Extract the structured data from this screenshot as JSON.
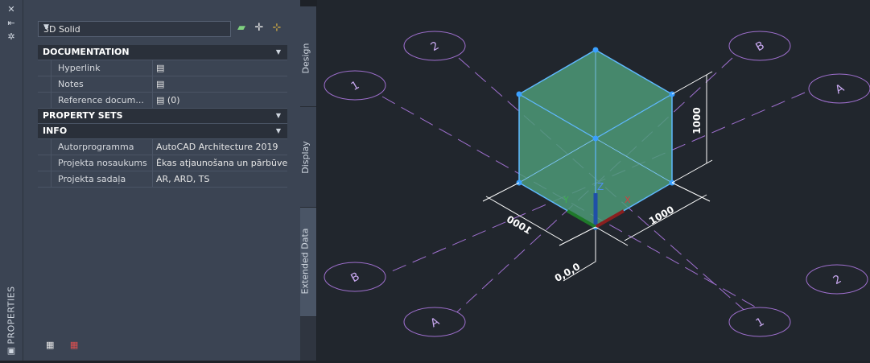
{
  "sidebar": {
    "title": "PROPERTIES",
    "icons": [
      "close-icon",
      "auto-hide-icon",
      "settings-icon",
      "properties-icon"
    ]
  },
  "object_selector": {
    "value": "3D Solid",
    "tool_icons": [
      "add-object-icon",
      "select-objects-icon",
      "quick-select-icon"
    ]
  },
  "sections": [
    {
      "title": "DOCUMENTATION",
      "rows": [
        {
          "key": "Hyperlink",
          "value": ""
        },
        {
          "key": "Notes",
          "value": ""
        },
        {
          "key": "Reference docum...",
          "value": "(0)"
        }
      ]
    },
    {
      "title": "PROPERTY SETS",
      "rows": []
    },
    {
      "title": "INFO",
      "rows": [
        {
          "key": "Autorprogramma",
          "value": "AutoCAD Architecture 2019"
        },
        {
          "key": "Projekta nosaukums",
          "value": "Ēkas atjaunošana un pārbūve"
        },
        {
          "key": "Projekta sadaļa",
          "value": "AR, ARD, TS"
        }
      ]
    }
  ],
  "tabs": [
    {
      "label": "Design",
      "active": false
    },
    {
      "label": "Display",
      "active": false
    },
    {
      "label": "Extended Data",
      "active": true
    }
  ],
  "bottom_icons": [
    "add-property-set-icon",
    "remove-property-set-icon"
  ],
  "drawing": {
    "grid_bubbles": [
      "2",
      "B",
      "1",
      "A",
      "B",
      "2",
      "A",
      "1"
    ],
    "dimensions": [
      "1000",
      "1000",
      "1000"
    ],
    "origin_label": "0,0,0",
    "axis_labels": {
      "x": "X",
      "y": "Y",
      "z": "Z"
    },
    "colors": {
      "gridline": "#a070d0",
      "solid_fill": "#4c9a78",
      "solid_edge": "#5fb8ff",
      "dimension": "#ffffff"
    }
  }
}
